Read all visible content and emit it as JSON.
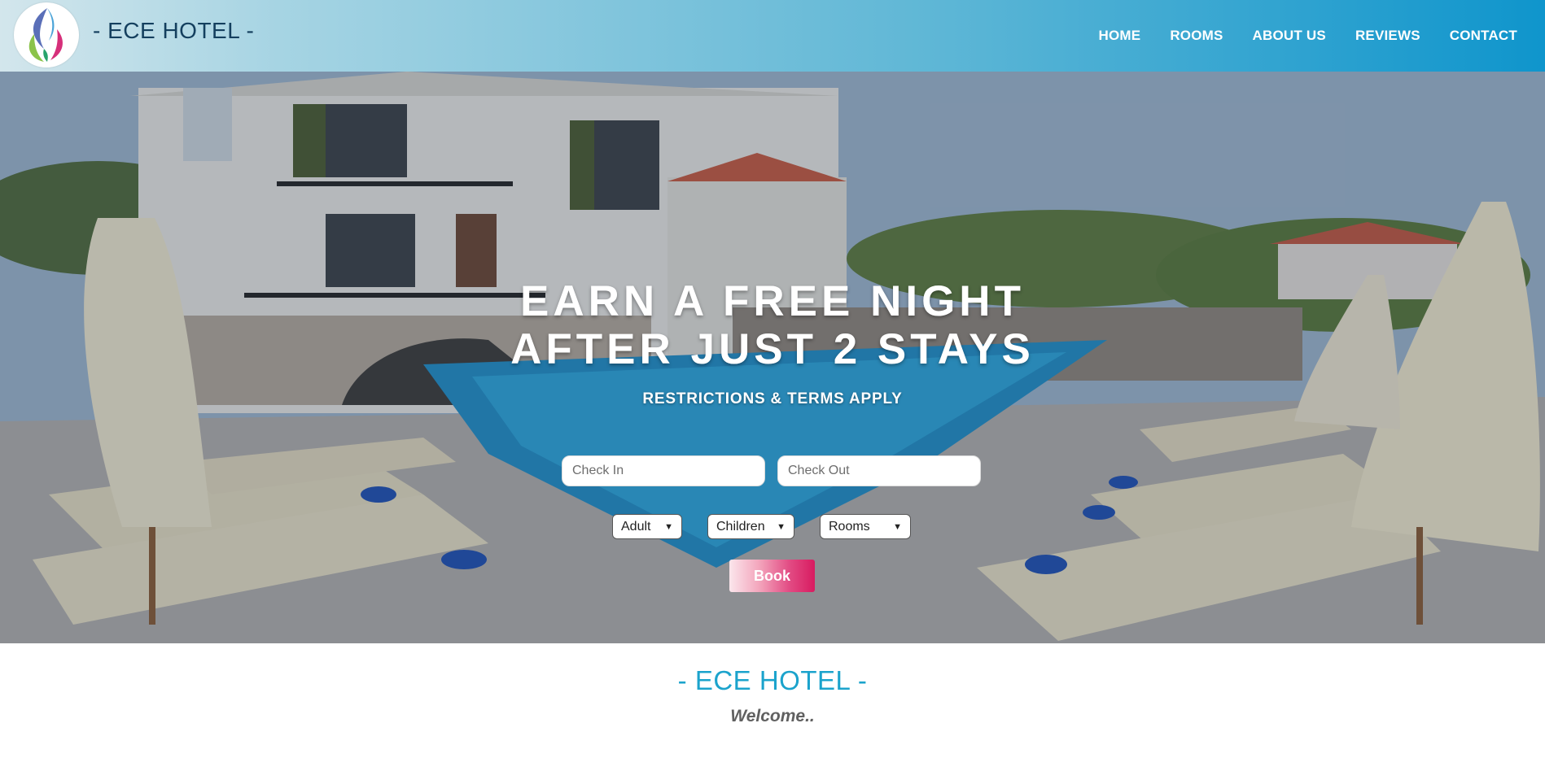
{
  "header": {
    "brand": "- ECE HOTEL -",
    "nav": [
      "HOME",
      "ROOMS",
      "ABOUT US",
      "REVIEWS",
      "CONTACT"
    ]
  },
  "hero": {
    "headline_line1": "EARN A FREE NIGHT",
    "headline_line2": "AFTER JUST 2 STAYS",
    "subline": "RESTRICTIONS & TERMS APPLY",
    "check_in_placeholder": "Check In",
    "check_out_placeholder": "Check Out",
    "adult_label": "Adult",
    "children_label": "Children",
    "rooms_label": "Rooms",
    "book_label": "Book"
  },
  "welcome": {
    "title": "- ECE HOTEL -",
    "subtitle": "Welcome.."
  },
  "colors": {
    "header_start": "#d3e6ec",
    "header_end": "#0f95cc",
    "brand_text": "#143f5e",
    "welcome_title": "#1ba3cc",
    "book_button": "#d81b60"
  }
}
